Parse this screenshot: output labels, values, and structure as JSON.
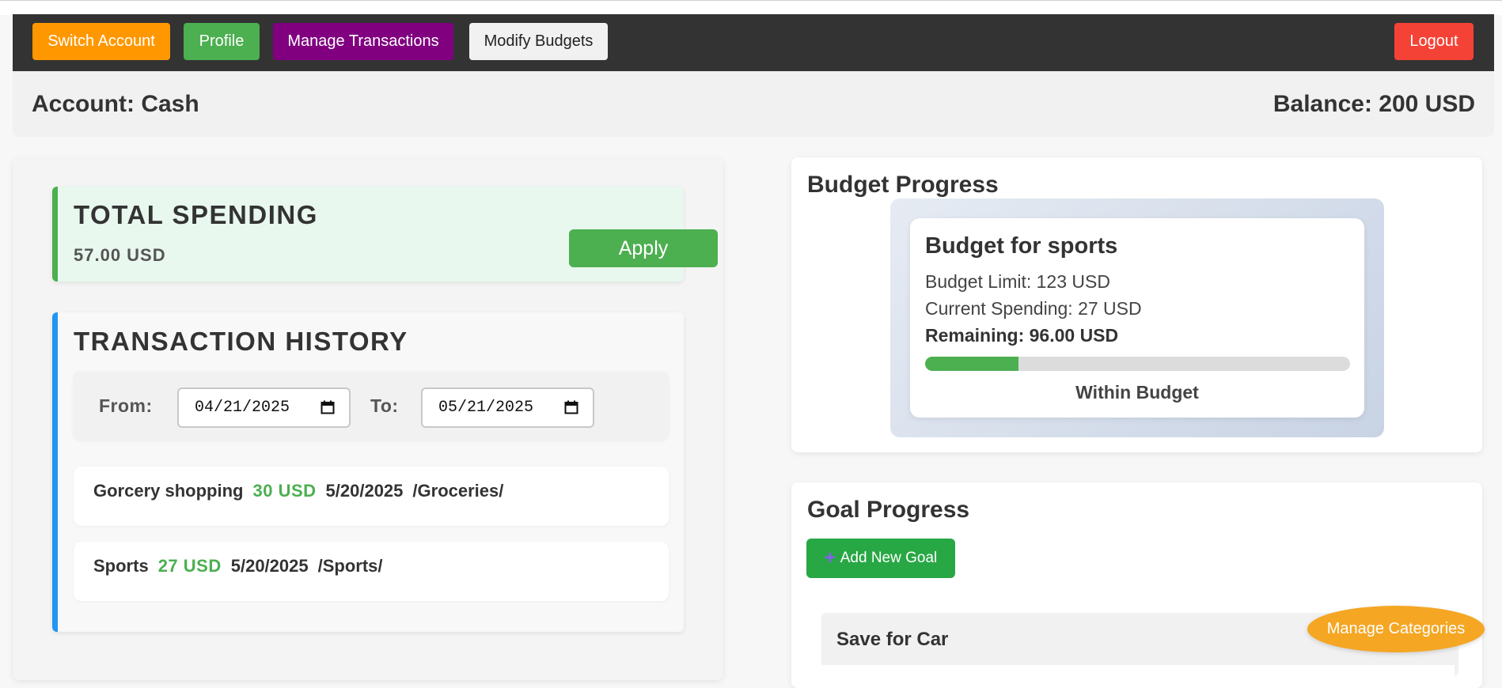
{
  "nav": {
    "switch_account": "Switch Account",
    "profile": "Profile",
    "manage_transactions": "Manage Transactions",
    "modify_budgets": "Modify Budgets",
    "logout": "Logout"
  },
  "account": {
    "name": "Account: Cash",
    "balance": "Balance: 200 USD"
  },
  "total_spending": {
    "title": "TOTAL SPENDING",
    "value": "57.00 USD"
  },
  "history": {
    "title": "TRANSACTION HISTORY",
    "from_label": "From:",
    "to_label": "To:",
    "from_date": "04/21/2025",
    "to_date": "05/21/2025",
    "apply": "Apply",
    "transactions": [
      {
        "description": "Gorcery shopping",
        "amount": "30 USD",
        "date": "5/20/2025",
        "category": "/Groceries/"
      },
      {
        "description": "Sports",
        "amount": "27 USD",
        "date": "5/20/2025",
        "category": "/Sports/"
      }
    ]
  },
  "budget": {
    "title": "Budget Progress",
    "card": {
      "name": "Budget for sports",
      "limit": "Budget Limit: 123 USD",
      "spending": "Current Spending: 27 USD",
      "remaining": "Remaining: 96.00 USD",
      "progress": 0.22,
      "status": "Within Budget"
    }
  },
  "goals": {
    "title": "Goal Progress",
    "add_button": "Add New Goal",
    "items": [
      {
        "name": "Save for Car"
      }
    ]
  },
  "manage_categories": "Manage Categories",
  "colors": {
    "navbar": "#333333",
    "switch_account": "#ff9800",
    "profile": "#4caf50",
    "manage_transactions": "#800080",
    "logout": "#f44336",
    "amount": "#4caf50",
    "history_accent": "#2196f3",
    "manage_categories": "#f5a623"
  }
}
